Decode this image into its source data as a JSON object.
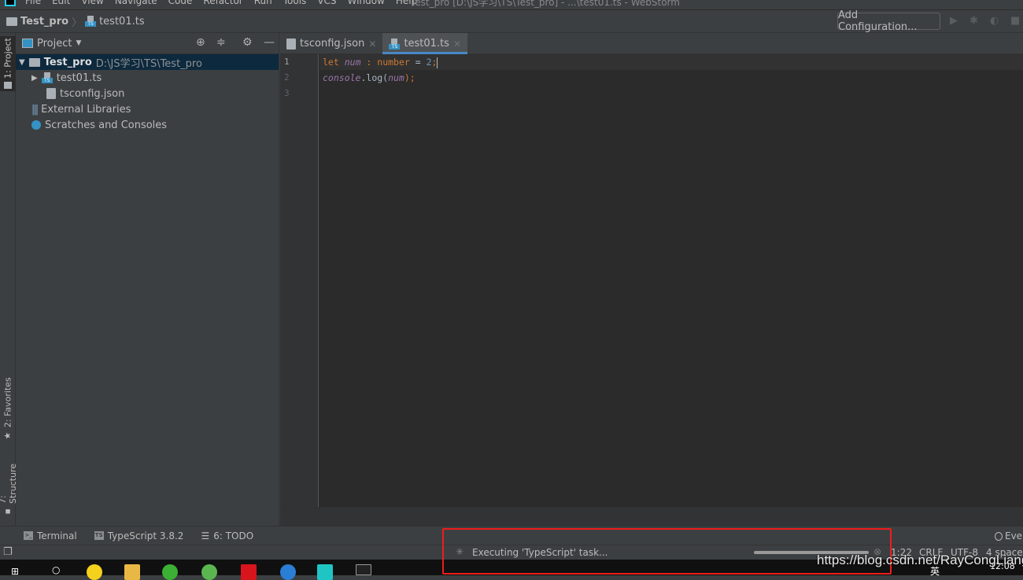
{
  "menubar": {
    "items": [
      "File",
      "Edit",
      "View",
      "Navigate",
      "Code",
      "Refactor",
      "Run",
      "Tools",
      "VCS",
      "Window",
      "Help"
    ],
    "title": "Test_pro [D:\\JS学习\\TS\\Test_pro] - ...\\test01.ts - WebStorm"
  },
  "navbar": {
    "project": "Test_pro",
    "file": "test01.ts",
    "add_configuration": "Add Configuration..."
  },
  "left_stripe": {
    "project": "1: Project",
    "favorites": "2: Favorites",
    "structure": "7: Structure"
  },
  "project_panel": {
    "title": "Project",
    "tree": [
      {
        "label": "Test_pro",
        "path": "D:\\JS学习\\TS\\Test_pro"
      },
      {
        "label": "test01.ts"
      },
      {
        "label": "tsconfig.json"
      },
      {
        "label": "External Libraries"
      },
      {
        "label": "Scratches and Consoles"
      }
    ]
  },
  "editor": {
    "tabs": [
      {
        "label": "tsconfig.json"
      },
      {
        "label": "test01.ts",
        "active": true
      }
    ],
    "line_numbers": [
      "1",
      "2",
      "3"
    ],
    "code": {
      "l1": {
        "kw": "let",
        "var": "num",
        "colon": " : ",
        "type": "number",
        "eq": " = ",
        "num": "2",
        "semi": ";"
      },
      "l2": {
        "obj": "console",
        "dot": ".log(",
        "arg": "num",
        "end": ");"
      }
    }
  },
  "tool_windows": {
    "terminal": "Terminal",
    "typescript": "TypeScript 3.8.2",
    "todo": "6: TODO",
    "event_log": "Eve"
  },
  "status": {
    "task": "Executing 'TypeScript' task...",
    "progress_percent": 100,
    "position": "1:22",
    "line_sep": "CRLF",
    "encoding": "UTF-8",
    "indent": "4 space"
  },
  "taskbar": {
    "time": "12:08",
    "ime": "英"
  },
  "watermark": "https://blog.csdn.net/RayCongLiang",
  "colors": {
    "highlight_box": "#f01c1c",
    "accent": "#4a88c7",
    "selection": "#0d293e"
  }
}
